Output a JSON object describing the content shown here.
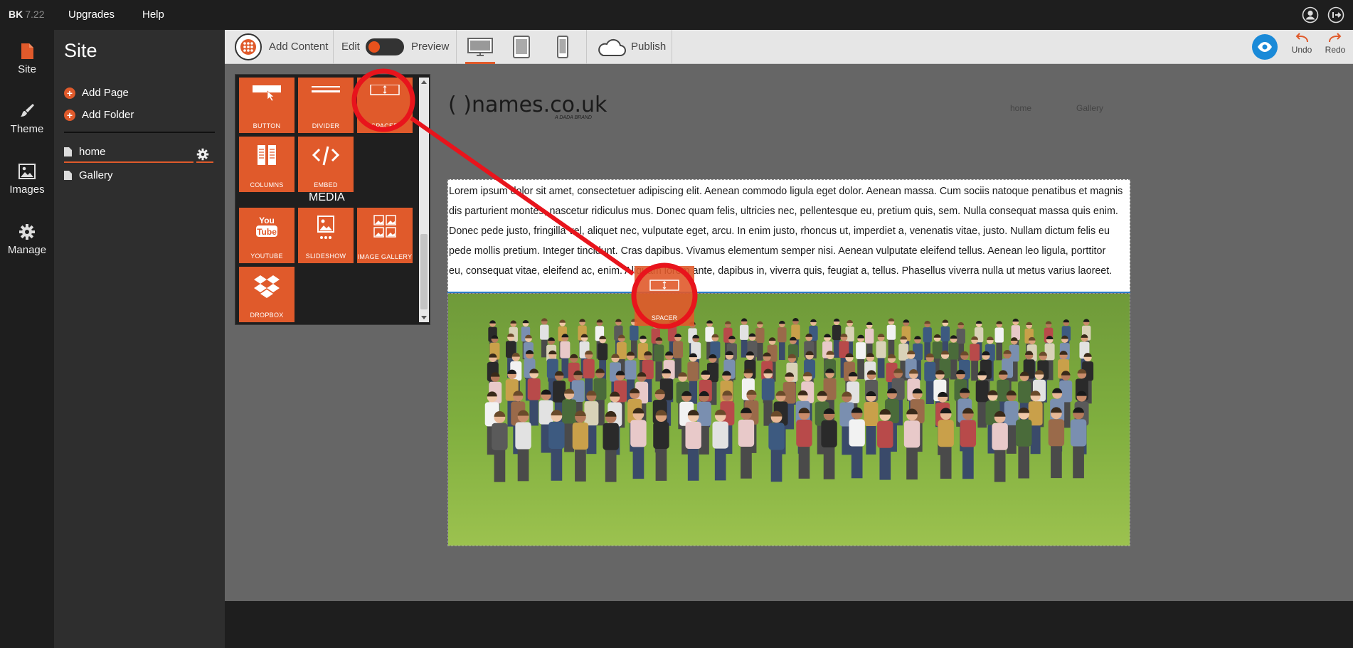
{
  "topbar": {
    "brand": "BK",
    "version": "7.22",
    "menu": [
      "Upgrades",
      "Help"
    ]
  },
  "rail": {
    "items": [
      {
        "label": "Site",
        "icon": "page-icon"
      },
      {
        "label": "Theme",
        "icon": "brush-icon"
      },
      {
        "label": "Images",
        "icon": "image-icon"
      },
      {
        "label": "Manage",
        "icon": "gear-icon"
      }
    ]
  },
  "site_panel": {
    "title": "Site",
    "add_page": "Add Page",
    "add_folder": "Add Folder",
    "pages": [
      "home",
      "Gallery"
    ]
  },
  "toolbar": {
    "add_content": "Add Content",
    "edit": "Edit",
    "preview": "Preview",
    "publish": "Publish",
    "undo": "Undo",
    "redo": "Redo"
  },
  "add_content_panel": {
    "tiles": [
      "BUTTON",
      "DIVIDER",
      "SPACER",
      "COLUMNS",
      "EMBED"
    ],
    "media_heading": "MEDIA",
    "media_tiles": [
      "YOUTUBE",
      "SLIDESHOW",
      "IMAGE GALLERY",
      "DROPBOX"
    ]
  },
  "drag_ghost": {
    "label": "SPACER"
  },
  "site_preview": {
    "logo": "( )names.co.uk",
    "logo_tagline": "A DADA BRAND",
    "nav": [
      "home",
      "Gallery"
    ],
    "text_lines": [
      "Lorem ipsum dolor sit amet, consectetuer adipiscing elit. Aenean commodo ligula eget dolor. Aenean massa. Cum sociis natoque penatibus et magnis",
      "dis parturient montes, nascetur ridiculus mus. Donec quam felis, ultricies nec, pellentesque eu, pretium quis, sem. Nulla consequat massa quis enim.",
      "Donec pede justo, fringilla vel, aliquet nec, vulputate eget, arcu. In enim justo, rhoncus ut, imperdiet a, venenatis vitae, justo. Nullam dictum felis eu",
      "pede mollis pretium. Integer tincidunt. Cras dapibus. Vivamus elementum semper nisi. Aenean vulputate eleifend tellus. Aenean leo ligula, porttitor",
      "eu, consequat vitae, eleifend ac, enim. Aliquam lorem ante, dapibus in, viverra quis, feugiat a, tellus. Phasellus viverra nulla ut metus varius laoreet."
    ]
  },
  "colors": {
    "accent": "#e05a2b",
    "annotation_red": "#e8141c",
    "eye_blue": "#1a8ad8"
  }
}
